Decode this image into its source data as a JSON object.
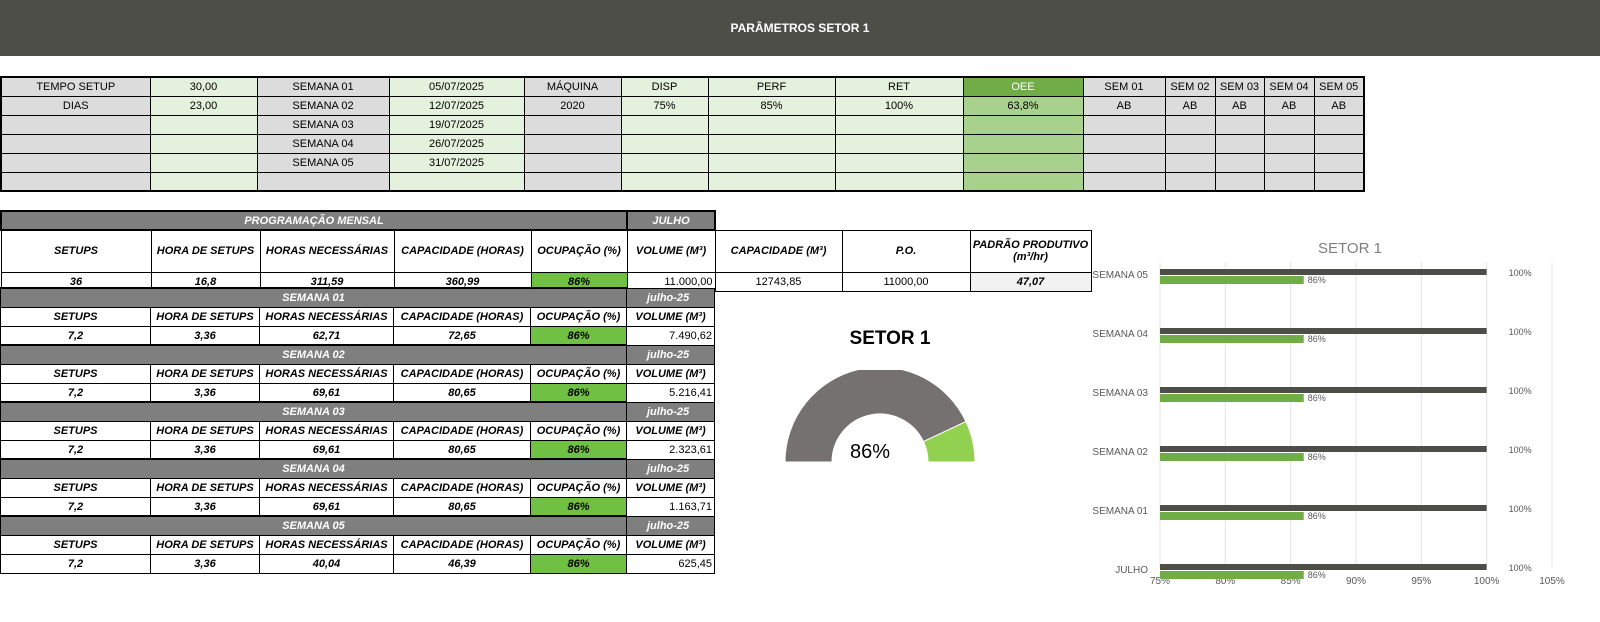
{
  "header": {
    "title": "PARÂMETROS SETOR 1"
  },
  "params": {
    "row1": [
      "TEMPO SETUP",
      "30,00",
      "SEMANA 01",
      "05/07/2025",
      "MÁQUINA",
      "DISP",
      "PERF",
      "RET",
      "OEE",
      "SEM 01",
      "SEM 02",
      "SEM 03",
      "SEM 04",
      "SEM 05"
    ],
    "row2": [
      "DIAS",
      "23,00",
      "SEMANA 02",
      "12/07/2025",
      "2020",
      "75%",
      "85%",
      "100%",
      "63,8%",
      "AB",
      "AB",
      "AB",
      "AB",
      "AB"
    ],
    "weeks_extra": [
      {
        "label": "SEMANA 03",
        "date": "19/07/2025"
      },
      {
        "label": "SEMANA 04",
        "date": "26/07/2025"
      },
      {
        "label": "SEMANA 05",
        "date": "31/07/2025"
      }
    ]
  },
  "programacao": {
    "title": "PROGRAMAÇÃO MENSAL",
    "month": "JULHO",
    "headers": [
      "SETUPS",
      "HORA DE SETUPS",
      "HORAS NECESSÁRIAS",
      "CAPACIDADE (HORAS)",
      "OCUPAÇÃO (%)",
      "VOLUME (M³)",
      "CAPACIDADE (M³)",
      "P.O.",
      "PADRÃO PRODUTIVO (m³/hr)"
    ],
    "monthly": [
      "36",
      "16,8",
      "311,59",
      "360,99",
      "86%",
      "11.000,00",
      "12743,85",
      "11000,00",
      "47,07"
    ],
    "sub_headers": [
      "SETUPS",
      "HORA DE SETUPS",
      "HORAS NECESSÁRIAS",
      "CAPACIDADE (HORAS)",
      "OCUPAÇÃO (%)",
      "VOLUME (M³)"
    ],
    "weeks": [
      {
        "title": "SEMANA 01",
        "month": "julho-25",
        "values": [
          "7,2",
          "3,36",
          "62,71",
          "72,65",
          "86%",
          "7.490,62"
        ]
      },
      {
        "title": "SEMANA 02",
        "month": "julho-25",
        "values": [
          "7,2",
          "3,36",
          "69,61",
          "80,65",
          "86%",
          "5.216,41"
        ]
      },
      {
        "title": "SEMANA 03",
        "month": "julho-25",
        "values": [
          "7,2",
          "3,36",
          "69,61",
          "80,65",
          "86%",
          "2.323,61"
        ]
      },
      {
        "title": "SEMANA 04",
        "month": "julho-25",
        "values": [
          "7,2",
          "3,36",
          "69,61",
          "80,65",
          "86%",
          "1.163,71"
        ]
      },
      {
        "title": "SEMANA 05",
        "month": "julho-25",
        "values": [
          "7,2",
          "3,36",
          "40,04",
          "46,39",
          "86%",
          "625,45"
        ]
      }
    ]
  },
  "gauge": {
    "title": "SETOR 1",
    "label": "86%",
    "value": 0.86,
    "fill_color": "#92d050",
    "rest_color": "#767171"
  },
  "chart_data": {
    "type": "bar",
    "orientation": "horizontal",
    "title": "SETOR 1",
    "categories": [
      "SEMANA 05",
      "SEMANA 04",
      "SEMANA 03",
      "SEMANA 02",
      "SEMANA 01",
      "JULHO"
    ],
    "series": [
      {
        "values": [
          100,
          100,
          100,
          100,
          100,
          100
        ],
        "labels": [
          "100%",
          "100%",
          "100%",
          "100%",
          "100%",
          "100%"
        ],
        "color": "#4d4e48"
      },
      {
        "values": [
          86,
          86,
          86,
          86,
          86,
          86
        ],
        "labels": [
          "86%",
          "86%",
          "86%",
          "86%",
          "86%",
          "86%"
        ],
        "color": "#70ad47"
      }
    ],
    "xlim": [
      75,
      105
    ],
    "xticks": [
      "75%",
      "80%",
      "85%",
      "90%",
      "95%",
      "100%",
      "105%"
    ],
    "grid": true
  }
}
